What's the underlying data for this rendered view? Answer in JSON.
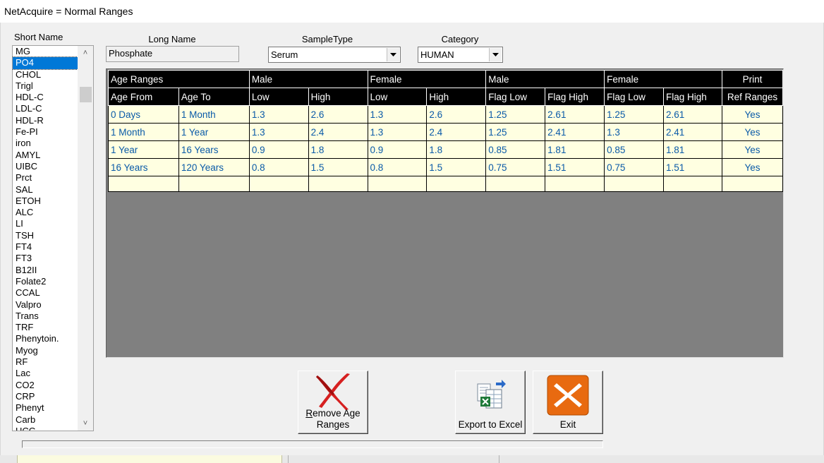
{
  "window": {
    "title": "NetAcquire = Normal Ranges"
  },
  "labels": {
    "short_name": "Short Name",
    "long_name": "Long Name",
    "sample_type": "SampleType",
    "category": "Category"
  },
  "short_names": [
    "MG",
    "PO4",
    "CHOL",
    "Trigl",
    "HDL-C",
    "LDL-C",
    "HDL-R",
    "Fe-PI",
    "iron",
    "AMYL",
    "UIBC",
    "Prct",
    "SAL",
    "ETOH",
    "ALC",
    "LI",
    "TSH",
    "FT4",
    "FT3",
    "B12II",
    "Folate2",
    "CCAL",
    "Valpro",
    "Trans",
    "TRF",
    "Phenytoin.",
    "Myog",
    "RF",
    "Lac",
    "CO2",
    "CRP",
    "Phenyt",
    "Carb",
    "HCG"
  ],
  "selected_short_name": "PO4",
  "long_name_value": "Phosphate",
  "sample_type_value": "Serum",
  "category_value": "HUMAN",
  "grid": {
    "group_headers": [
      "Age Ranges",
      "Male",
      "Female",
      "Male",
      "Female",
      "Print"
    ],
    "columns": [
      "Age From",
      "Age To",
      "Low",
      "High",
      "Low",
      "High",
      "Flag Low",
      "Flag High",
      "Flag Low",
      "Flag High",
      "Ref Ranges"
    ],
    "rows": [
      [
        "0 Days",
        "1 Month",
        "1.3",
        "2.6",
        "1.3",
        "2.6",
        "1.25",
        "2.61",
        "1.25",
        "2.61",
        "Yes"
      ],
      [
        "1 Month",
        "1 Year",
        "1.3",
        "2.4",
        "1.3",
        "2.4",
        "1.25",
        "2.41",
        "1.3",
        "2.41",
        "Yes"
      ],
      [
        "1 Year",
        "16 Years",
        "0.9",
        "1.8",
        "0.9",
        "1.8",
        "0.85",
        "1.81",
        "0.85",
        "1.81",
        "Yes"
      ],
      [
        "16 Years",
        "120 Years",
        "0.8",
        "1.5",
        "0.8",
        "1.5",
        "0.75",
        "1.51",
        "0.75",
        "1.51",
        "Yes"
      ]
    ]
  },
  "buttons": {
    "remove_mnemonic": "R",
    "remove_line1_rest": "emove Age",
    "remove_line2": "Ranges",
    "export": "Export to Excel",
    "exit": "Exit"
  },
  "colors": {
    "selection": "#0078d7",
    "grid_header_bg": "#000000",
    "grid_cell_bg": "#ffffe1",
    "grid_text": "#0a5aa8",
    "grid_pane_bg": "#808080",
    "exit_orange": "#e86a10"
  }
}
